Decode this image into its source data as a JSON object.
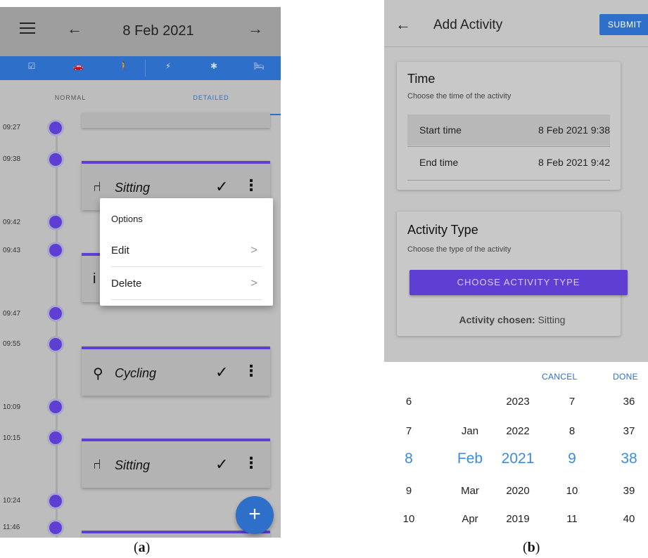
{
  "panel_a": {
    "app_bar": {
      "title": "8 Feb 2021",
      "back_arrow": "←",
      "forward_arrow": "→"
    },
    "icon_bar": {
      "icons": [
        "checkbox-icon",
        "vehicle-icon",
        "walk-icon",
        "bolt-icon",
        "asterisk-icon",
        "bed-icon"
      ],
      "glyphs": [
        "☑",
        "🚗",
        "🚶",
        "⚡",
        "✱",
        "🛏"
      ]
    },
    "tabs": [
      "NORMAL",
      "DETAILED"
    ],
    "times": [
      "09:27",
      "09:38",
      "09:42",
      "09:43",
      "09:47",
      "09:55",
      "10:09",
      "10:15",
      "10:24",
      "11:46"
    ],
    "cards": [
      {
        "label": "Sitting",
        "icon": "seat-icon",
        "glyph": "⑁"
      },
      {
        "label": "Cycling",
        "icon": "bicycle-icon",
        "glyph": "⚲"
      },
      {
        "label": "Sitting",
        "icon": "seat-icon",
        "glyph": "⑁"
      }
    ],
    "check_glyph": "✓",
    "more_glyph": "⋮",
    "popup": {
      "title": "Options",
      "items": [
        "Edit",
        "Delete"
      ],
      "chevron": ">"
    },
    "fab_label": "+",
    "caption_letter": "a"
  },
  "panel_b": {
    "app_bar": {
      "back_arrow": "←",
      "title": "Add Activity",
      "submit_label": "SUBMIT"
    },
    "time_card": {
      "title": "Time",
      "subtitle": "Choose the time of the activity",
      "start_label": "Start time",
      "start_value": "8 Feb 2021 9:38",
      "end_label": "End time",
      "end_value": "8 Feb 2021 9:42"
    },
    "activity_card": {
      "title": "Activity Type",
      "subtitle": "Choose the type of the activity",
      "button_label": "CHOOSE ACTIVITY TYPE",
      "chosen_prefix": "Activity chosen:",
      "chosen_value": " Sitting"
    },
    "picker": {
      "cancel_label": "CANCEL",
      "done_label": "DONE",
      "columns": [
        [
          "6",
          "7",
          "8",
          "9",
          "10"
        ],
        [
          "",
          "Jan",
          "Feb",
          "Mar",
          "Apr"
        ],
        [
          "2023",
          "2022",
          "2021",
          "2020",
          "2019"
        ],
        [
          "7",
          "8",
          "9",
          "10",
          "11"
        ],
        [
          "36",
          "37",
          "38",
          "39",
          "40"
        ]
      ],
      "selected_row": 2
    },
    "caption_letter": "b"
  },
  "colors": {
    "accent_blue": "#2e6fc9",
    "accent_purple": "#5f3fd3",
    "picker_selected": "#3c8be0"
  }
}
